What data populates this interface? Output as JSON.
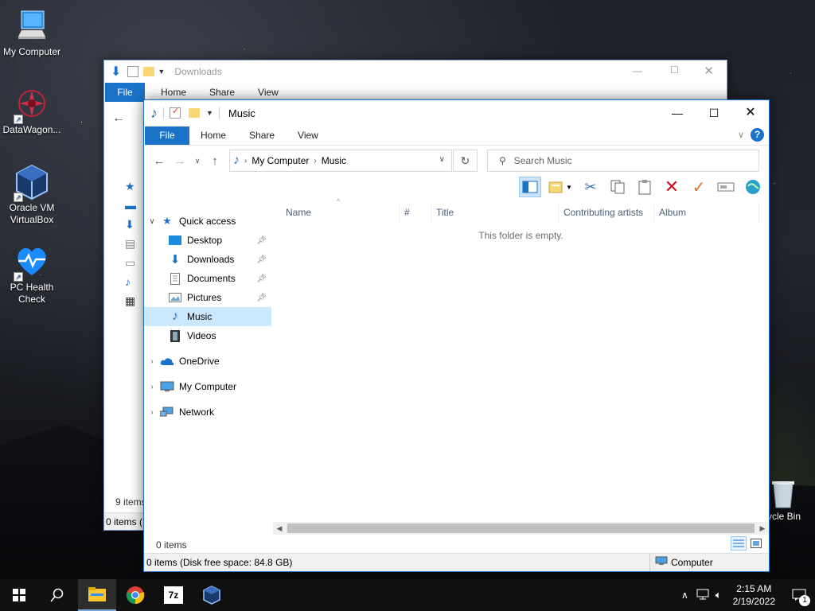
{
  "desktop": {
    "icons": [
      {
        "label": "My Computer"
      },
      {
        "label": "DataWagon..."
      },
      {
        "label": "Oracle VM VirtualBox"
      },
      {
        "label": "PC Health Check"
      },
      {
        "label": "ycle Bin"
      }
    ]
  },
  "back_window": {
    "title": "Downloads",
    "ribbon": {
      "file": "File",
      "tabs": [
        "Home",
        "Share",
        "View"
      ]
    },
    "status_items": "9 items",
    "status_bar": "0 items (D"
  },
  "window": {
    "title": "Music",
    "ribbon": {
      "file": "File",
      "tabs": [
        "Home",
        "Share",
        "View"
      ]
    },
    "address": {
      "segments": [
        "My Computer",
        "Music"
      ]
    },
    "search": {
      "placeholder": "Search Music"
    },
    "nav": {
      "quick_access": "Quick access",
      "items": [
        {
          "label": "Desktop",
          "pinned": true
        },
        {
          "label": "Downloads",
          "pinned": true
        },
        {
          "label": "Documents",
          "pinned": true
        },
        {
          "label": "Pictures",
          "pinned": true
        },
        {
          "label": "Music",
          "selected": true
        },
        {
          "label": "Videos"
        }
      ],
      "onedrive": "OneDrive",
      "my_computer": "My Computer",
      "network": "Network"
    },
    "columns": [
      "Name",
      "#",
      "Title",
      "Contributing artists",
      "Album"
    ],
    "empty_message": "This folder is empty.",
    "item_count": "0 items",
    "status_left": "0 items (Disk free space: 84.8 GB)",
    "status_right": "Computer"
  },
  "taskbar": {
    "time": "2:15 AM",
    "date": "2/19/2022",
    "notification_count": "1",
    "app_7z_label": "7z"
  },
  "colors": {
    "accent": "#1a73c8",
    "selection": "#cce8ff"
  }
}
